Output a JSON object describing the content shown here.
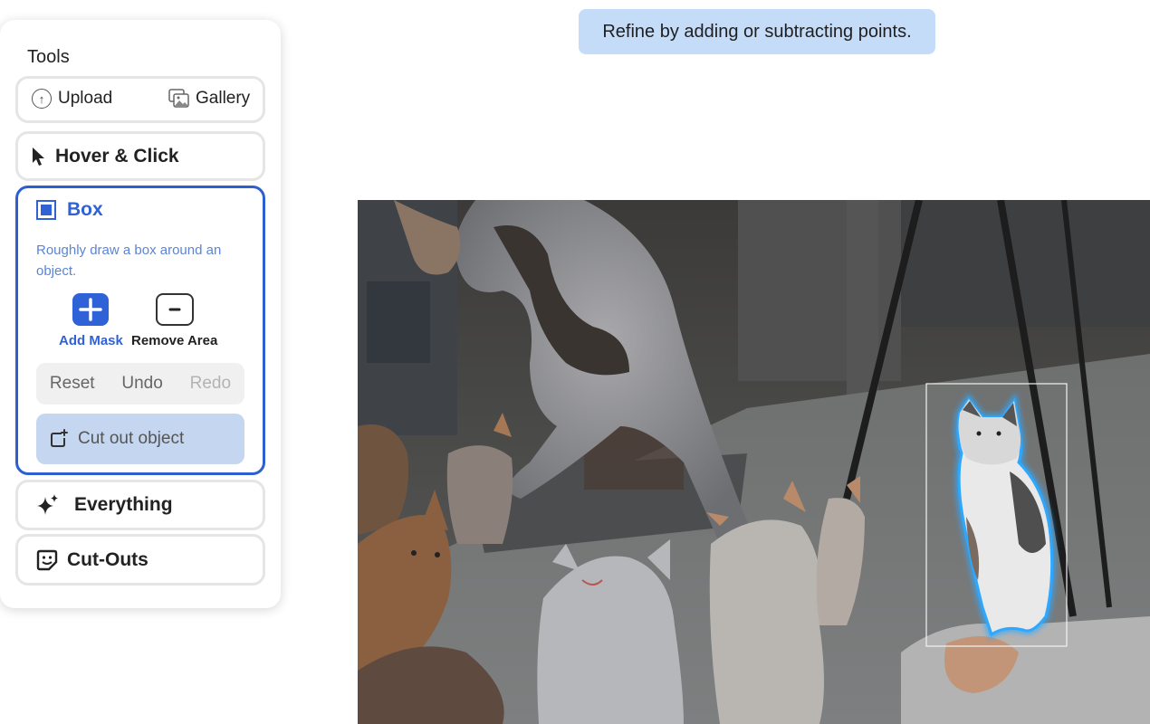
{
  "tools_panel": {
    "title": "Tools",
    "upload_label": "Upload",
    "gallery_label": "Gallery",
    "hover_click_label": "Hover & Click",
    "box": {
      "label": "Box",
      "description": "Roughly draw a box around an object.",
      "add_mask_label": "Add Mask",
      "remove_area_label": "Remove Area",
      "reset_label": "Reset",
      "undo_label": "Undo",
      "redo_label": "Redo",
      "cut_out_label": "Cut out object"
    },
    "everything_label": "Everything",
    "cutouts_label": "Cut-Outs"
  },
  "banner": {
    "text": "Refine by adding or subtracting points."
  },
  "colors": {
    "accent": "#2f62d6",
    "banner_bg": "#c5dcf9",
    "cutout_bg": "#c5d6f0",
    "mask_outline": "#2ea8ff"
  },
  "icons": {
    "upload": "upload-arrow-icon",
    "gallery": "gallery-icon",
    "hover_click": "cursor-pointer-icon",
    "box": "box-select-icon",
    "add": "plus-icon",
    "remove": "minus-icon",
    "cut_out": "crop-add-icon",
    "everything": "sparkles-icon",
    "cutouts": "sticker-icon"
  }
}
